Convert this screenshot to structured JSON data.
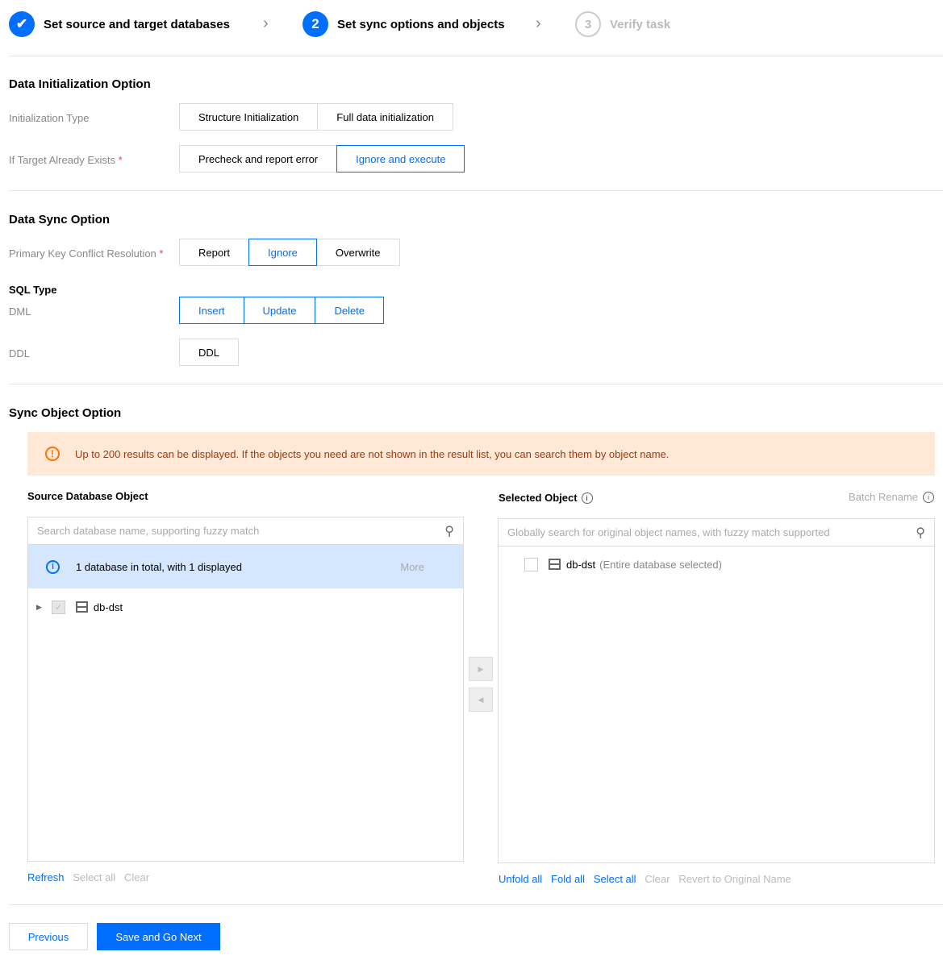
{
  "steps": [
    {
      "label": "Set source and target databases",
      "state": "done"
    },
    {
      "number": "2",
      "label": "Set sync options and objects",
      "state": "active"
    },
    {
      "number": "3",
      "label": "Verify task",
      "state": "pending"
    }
  ],
  "accent": "#006eff",
  "data_init": {
    "title": "Data Initialization Option",
    "init_type_label": "Initialization Type",
    "init_type_options": [
      "Structure Initialization",
      "Full data initialization"
    ],
    "target_exists_label": "If Target Already Exists",
    "target_exists_options": [
      "Precheck and report error",
      "Ignore and execute"
    ],
    "target_exists_selected": "Ignore and execute"
  },
  "data_sync": {
    "title": "Data Sync Option",
    "pk_label": "Primary Key Conflict Resolution",
    "pk_options": [
      "Report",
      "Ignore",
      "Overwrite"
    ],
    "pk_selected": "Ignore",
    "sql_type_label": "SQL Type",
    "dml_label": "DML",
    "dml_options": [
      "Insert",
      "Update",
      "Delete"
    ],
    "ddl_label": "DDL",
    "ddl_option": "DDL"
  },
  "sync_object": {
    "title": "Sync Object Option",
    "warning": "Up to 200 results can be displayed. If the objects you need are not shown in the result list, you can search them by object name.",
    "source": {
      "title": "Source Database Object",
      "search_placeholder": "Search database name, supporting fuzzy match",
      "info": "1 database in total, with 1 displayed",
      "more": "More",
      "items": [
        {
          "name": "db-dst",
          "checked": true
        }
      ],
      "actions": [
        "Refresh",
        "Select all",
        "Clear"
      ]
    },
    "selected": {
      "title": "Selected Object",
      "batch_rename": "Batch Rename",
      "search_placeholder": "Globally search for original object names, with fuzzy match supported",
      "items": [
        {
          "name": "db-dst",
          "note": "(Entire database selected)"
        }
      ],
      "actions": [
        "Unfold all",
        "Fold all",
        "Select all",
        "Clear",
        "Revert to Original Name"
      ]
    }
  },
  "footer": {
    "previous": "Previous",
    "next": "Save and Go Next"
  }
}
